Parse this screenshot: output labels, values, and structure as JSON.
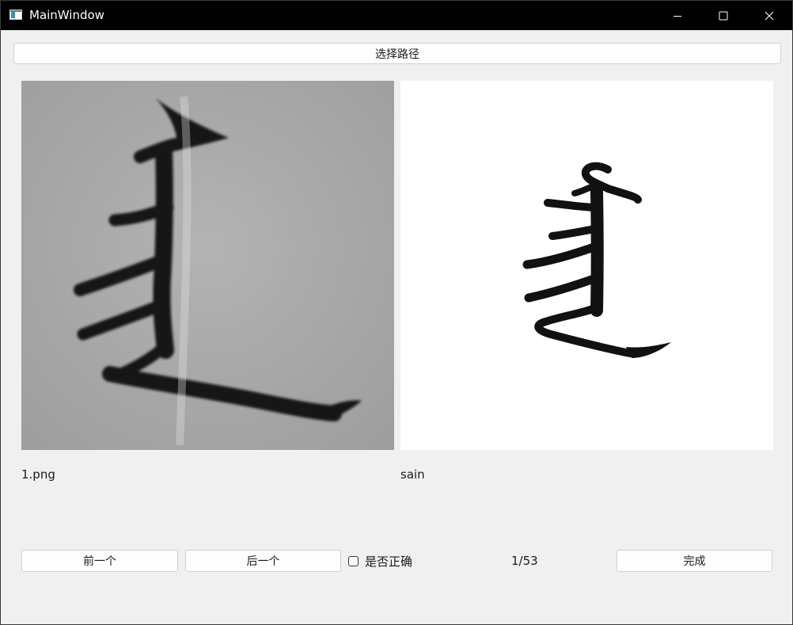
{
  "window": {
    "title": "MainWindow",
    "caption_icons": [
      "minimize-icon",
      "maximize-icon",
      "close-icon"
    ]
  },
  "toolbar": {
    "select_path_label": "选择路径"
  },
  "images": {
    "source_filename": "1.png",
    "predicted_label": "sain"
  },
  "controls": {
    "prev_label": "前一个",
    "next_label": "后一个",
    "correct_checkbox_label": "是否正确",
    "correct_checked": false,
    "counter": "1/53",
    "done_label": "完成"
  },
  "colors": {
    "titlebar_bg": "#000000",
    "window_bg": "#f0f0f0",
    "button_bg": "#fdfdfd",
    "button_border": "#d0d0d0",
    "scan_bg": "#a9a9aa",
    "ink": "#111111"
  }
}
